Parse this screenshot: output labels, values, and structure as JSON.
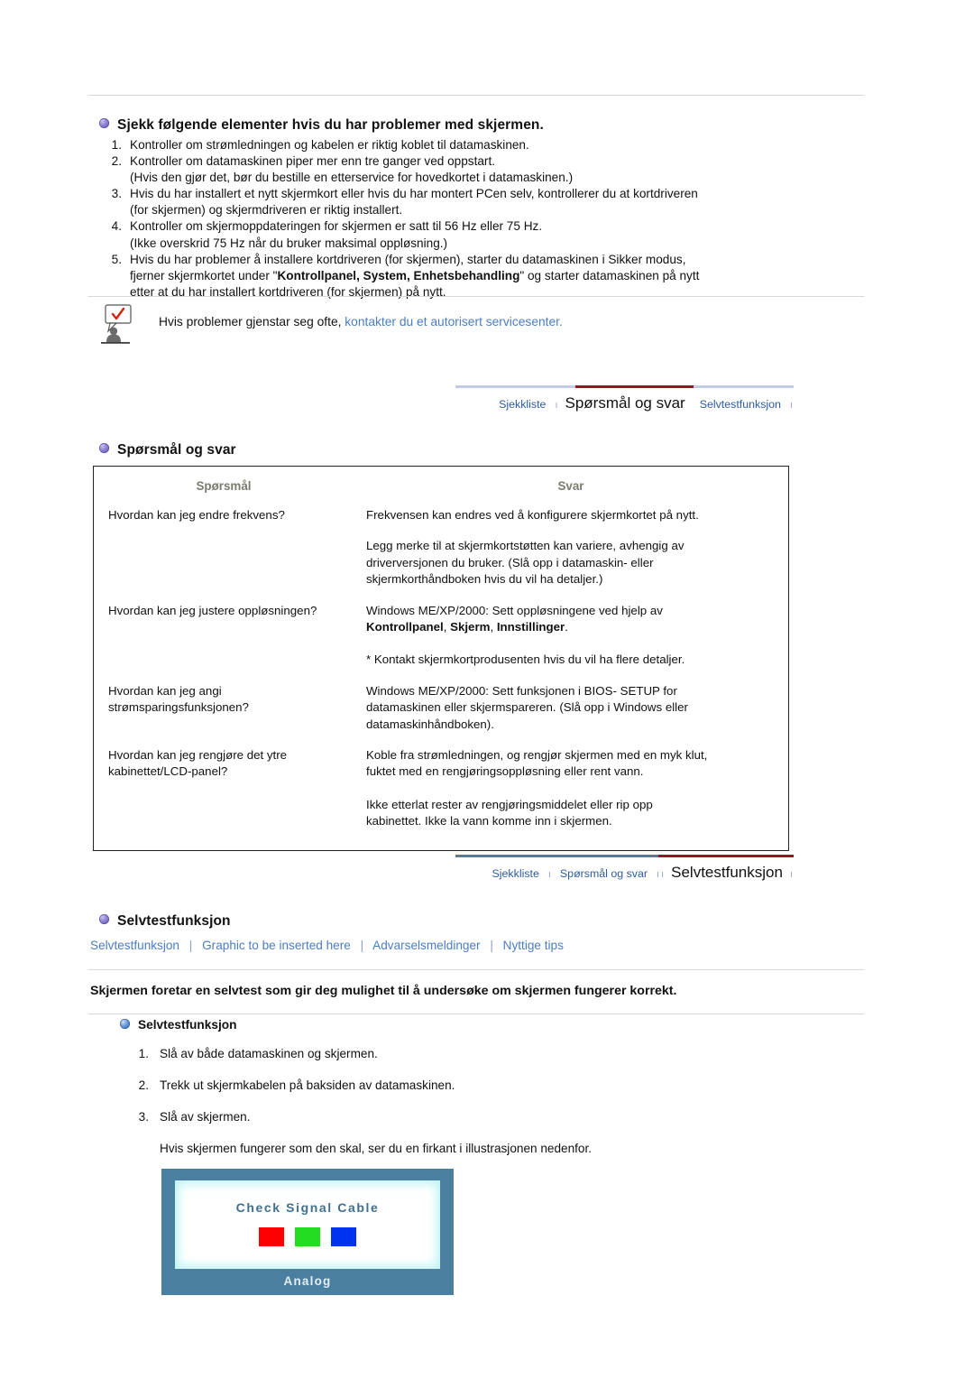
{
  "troubleshooting": {
    "heading": "Sjekk følgende elementer hvis du har problemer med skjermen.",
    "items": [
      {
        "num": "1.",
        "lines": [
          "Kontroller om strømledningen og kabelen er riktig koblet til datamaskinen."
        ]
      },
      {
        "num": "2.",
        "lines": [
          "Kontroller om datamaskinen piper mer enn tre ganger ved oppstart.",
          "(Hvis den gjør det, bør du bestille en etterservice for hovedkortet i datamaskinen.)"
        ]
      },
      {
        "num": "3.",
        "lines": [
          "Hvis du har installert et nytt skjermkort eller hvis du har montert PCen selv, kontrollerer du at kortdriveren",
          "(for skjermen) og skjermdriveren er riktig installert."
        ]
      },
      {
        "num": "4.",
        "lines": [
          "Kontroller om skjermoppdateringen for skjermen er satt til 56 Hz eller 75 Hz.",
          "(Ikke overskrid 75 Hz når du bruker maksimal oppløsning.)"
        ]
      },
      {
        "num": "5.",
        "line5_a": "Hvis du har problemer å installere kortdriveren (for skjermen), starter du datamaskinen i Sikker modus,",
        "line5_b_pre": "fjerner skjermkortet under \"",
        "line5_b_bold": "Kontrollpanel, System, Enhetsbehandling",
        "line5_b_post": "\" og starter datamaskinen på nytt",
        "line5_c": "etter at du har installert kortdriveren (for skjermen) på nytt."
      }
    ]
  },
  "note": {
    "icon": "person-with-checkmark-speech-bubble-icon",
    "text": "Hvis problemer gjenstar seg ofte, ",
    "link": "kontakter du et autorisert servicesenter."
  },
  "nav1": {
    "items": [
      {
        "label": "Sjekkliste",
        "active": false
      },
      {
        "label": "Spørsmål og svar",
        "active": true
      },
      {
        "label": "Selvtestfunksjon",
        "active": false
      }
    ],
    "separator": "ı",
    "rail_color": "#c3cce6",
    "active_color": "#9c1220"
  },
  "nav2": {
    "items": [
      {
        "label": "Sjekkliste",
        "active": false
      },
      {
        "label": "Spørsmål og svar",
        "active": false
      },
      {
        "label": "Selvtestfunksjon",
        "active": true
      }
    ],
    "separator": "ı",
    "rail_color": "#4a7ea6",
    "active_color": "#9c1220"
  },
  "faq": {
    "heading": "Spørsmål og svar",
    "columns": [
      "Spørsmål",
      "Svar"
    ],
    "rows": [
      {
        "question": "Hvordan kan jeg endre frekvens?",
        "answer_lines": [
          "Frekvensen kan endres ved å konfigurere skjermkortet på nytt."
        ]
      },
      {
        "question": "",
        "answer_lines": [
          "Legg merke til at skjermkortstøtten kan variere, avhengig av",
          "driverversjonen du bruker. (Slå opp i datamaskin- eller",
          "skjermkorthåndboken hvis du vil ha detaljer.)"
        ]
      },
      {
        "question": "Hvordan kan jeg justere oppløsningen?",
        "answer_line1": "Windows ME/XP/2000: Sett oppløsningene ved hjelp av",
        "answer_bold_a": "Kontrollpanel",
        "answer_bold_b": "Skjerm",
        "answer_bold_c": "Innstillinger",
        "answer_line3": "* Kontakt skjermkortprodusenten hvis du vil ha flere detaljer."
      },
      {
        "question_line1": "Hvordan kan jeg angi",
        "question_line2": "strømsparingsfunksjonen?",
        "answer_lines": [
          "Windows ME/XP/2000: Sett funksjonen i BIOS- SETUP for",
          "datamaskinen eller skjermspareren. (Slå opp i Windows eller",
          "datamaskinhåndboken)."
        ]
      },
      {
        "question_line1": "Hvordan kan jeg rengjøre det ytre",
        "question_line2": "kabinettet/LCD-panel?",
        "answer_lines": [
          "Koble fra strømledningen, og rengjør skjermen med en myk klut,",
          "fuktet med en rengjøringsoppløsning eller rent vann."
        ],
        "answer_lines2": [
          "Ikke etterlat rester av rengjøringsmiddelet eller rip opp",
          "kabinettet. Ikke la vann komme inn i skjermen."
        ]
      }
    ]
  },
  "selftest": {
    "heading": "Selvtestfunksjon",
    "sub_links": [
      "Selvtestfunksjon",
      "Graphic to be inserted here",
      "Advarselsmeldinger",
      "Nyttige tips"
    ],
    "link_separator": "|",
    "bold_statement": "Skjermen foretar en selvtest som gir deg mulighet til å undersøke om skjermen fungerer korrekt.",
    "sub_heading": "Selvtestfunksjon",
    "steps": [
      {
        "num": "1.",
        "text": "Slå av både datamaskinen og skjermen."
      },
      {
        "num": "2.",
        "text": "Trekk ut skjermkabelen på baksiden av datamaskinen."
      },
      {
        "num": "3.",
        "text": "Slå av skjermen."
      }
    ],
    "closing_note": "Hvis skjermen fungerer som den skal, ser du en firkant i illustrasjonen nedenfor."
  },
  "monitor": {
    "screen_title": "Check Signal Cable",
    "caption": "Analog",
    "frame_color": "#4a7fa0",
    "swatches": [
      {
        "name": "red-swatch",
        "color": "#ff0000"
      },
      {
        "name": "green-swatch",
        "color": "#22dd22"
      },
      {
        "name": "blue-swatch",
        "color": "#0033ee"
      }
    ]
  }
}
